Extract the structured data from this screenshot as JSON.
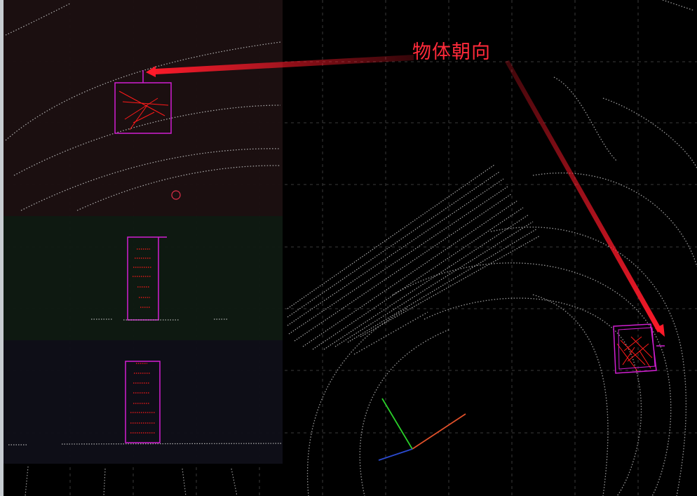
{
  "annotation": {
    "label": "物体朝向"
  },
  "colors": {
    "background": "#000000",
    "grid": "#3a3a3a",
    "point_cloud": "#9a9a9a",
    "object_points": "#ff1a1a",
    "bounding_box": "#d21fd2",
    "arrow": "#ff1a2a",
    "top_view_panel": "#1c1011",
    "side_view_panel": "#0f1a12",
    "front_view_panel": "#0f0f18",
    "axis_x": "#e0502a",
    "axis_y": "#2ad02a",
    "axis_z": "#2a4ad0"
  },
  "icons": [
    "axis-gizmo-icon",
    "origin-marker-icon"
  ]
}
